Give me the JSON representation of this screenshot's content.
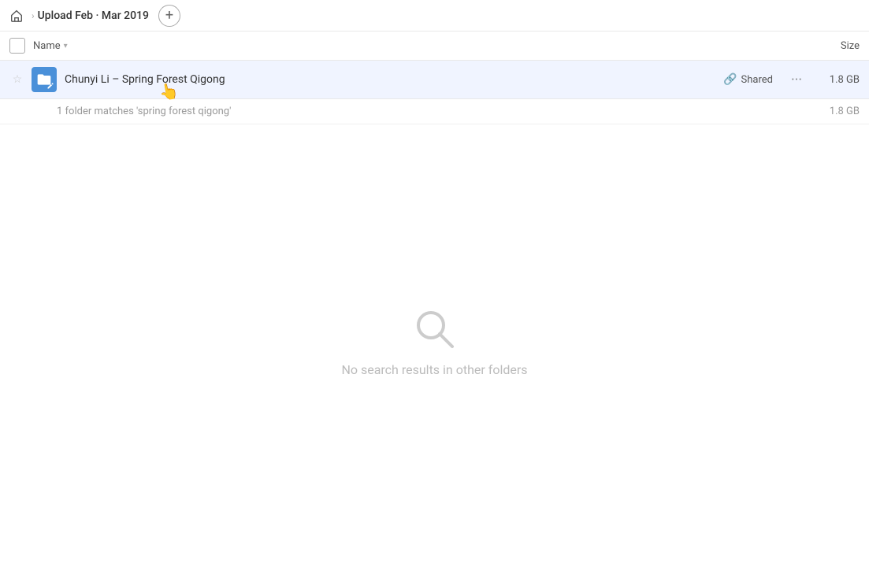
{
  "topbar": {
    "home_icon": "home-icon",
    "breadcrumb_label": "Upload Feb · Mar 2019",
    "add_button_label": "+"
  },
  "columns": {
    "name_label": "Name",
    "sort_arrow": "▾",
    "size_label": "Size"
  },
  "file_row": {
    "folder_name": "Chunyi Li – Spring Forest Qigong",
    "shared_label": "Shared",
    "size": "1.8 GB",
    "is_starred": false
  },
  "match_row": {
    "text": "1 folder matches 'spring forest qigong'",
    "size": "1.8 GB"
  },
  "empty_state": {
    "message": "No search results in other folders"
  }
}
